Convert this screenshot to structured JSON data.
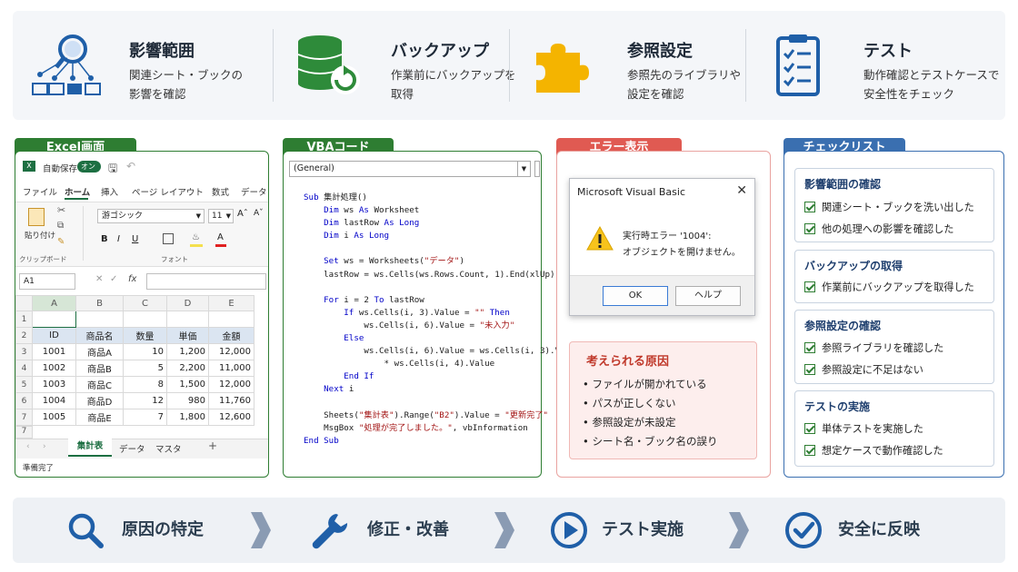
{
  "top": [
    {
      "title": "影響範囲",
      "desc1": "関連シート・ブックの",
      "desc2": "影響を確認",
      "icon": "search-network-icon"
    },
    {
      "title": "バックアップ",
      "desc1": "作業前にバックアップを",
      "desc2": "取得",
      "icon": "database-backup-icon"
    },
    {
      "title": "参照設定",
      "desc1": "参照先のライブラリや",
      "desc2": "設定を確認",
      "icon": "puzzle-icon"
    },
    {
      "title": "テスト",
      "desc1": "動作確認とテストケースで",
      "desc2": "安全性をチェック",
      "icon": "clipboard-checklist-icon"
    }
  ],
  "excel": {
    "tab": "Excel画面",
    "autosave": "自動保存",
    "toggle": "オン",
    "ribbon_tabs": [
      "ファイル",
      "ホーム",
      "挿入",
      "ページ レイアウト",
      "数式",
      "データ"
    ],
    "paste": "貼り付け",
    "font_name": "游ゴシック",
    "font_size": "11",
    "group_clipboard": "クリップボード",
    "group_font": "フォント",
    "namebox": "A1",
    "fx": "fx",
    "columns": [
      "A",
      "B",
      "C",
      "D",
      "E"
    ],
    "rows": [
      "1",
      "2",
      "3",
      "4",
      "5",
      "6",
      "7"
    ],
    "headers": [
      "ID",
      "商品名",
      "数量",
      "単価",
      "金額"
    ],
    "data": [
      [
        "1001",
        "商品A",
        "10",
        "1,200",
        "12,000"
      ],
      [
        "1002",
        "商品B",
        "5",
        "2,200",
        "11,000"
      ],
      [
        "1003",
        "商品C",
        "8",
        "1,500",
        "12,000"
      ],
      [
        "1004",
        "商品D",
        "12",
        "980",
        "11,760"
      ],
      [
        "1005",
        "商品E",
        "7",
        "1,800",
        "12,600"
      ]
    ],
    "sheets": [
      "集計表",
      "データ",
      "マスタ"
    ],
    "add_sheet": "+",
    "status": "準備完了"
  },
  "vba": {
    "tab": "VBAコード",
    "dropdown": "(General)"
  },
  "error": {
    "tab": "エラー表示",
    "dialog_title": "Microsoft Visual Basic",
    "message1": "実行時エラー '1004':",
    "message2": "オブジェクトを開けません。",
    "ok": "OK",
    "help": "ヘルプ",
    "cause_title": "考えられる原因",
    "causes": [
      "ファイルが開かれている",
      "パスが正しくない",
      "参照設定が未設定",
      "シート名・ブック名の誤り"
    ]
  },
  "checklist": {
    "tab": "チェックリスト",
    "groups": [
      {
        "title": "影響範囲の確認",
        "items": [
          "関連シート・ブックを洗い出した",
          "他の処理への影響を確認した"
        ]
      },
      {
        "title": "バックアップの取得",
        "items": [
          "作業前にバックアップを取得した"
        ]
      },
      {
        "title": "参照設定の確認",
        "items": [
          "参照ライブラリを確認した",
          "参照設定に不足はない"
        ]
      },
      {
        "title": "テストの実施",
        "items": [
          "単体テストを実施した",
          "想定ケースで動作確認した"
        ]
      }
    ]
  },
  "steps": [
    {
      "label": "原因の特定",
      "icon": "magnifier-icon"
    },
    {
      "label": "修正・改善",
      "icon": "wrench-icon"
    },
    {
      "label": "テスト実施",
      "icon": "play-icon"
    },
    {
      "label": "安全に反映",
      "icon": "check-circle-icon"
    }
  ],
  "colors": {
    "excel_green": "#2e7d32",
    "vba_green": "#2e7d32",
    "error_red": "#e05a52",
    "checklist_blue": "#3a6fb0",
    "icon_blue": "#1f5fa8"
  }
}
